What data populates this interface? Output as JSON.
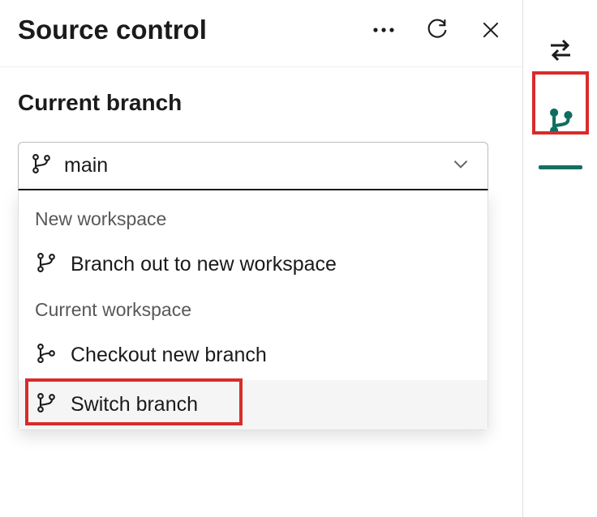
{
  "header": {
    "title": "Source control"
  },
  "section": {
    "label": "Current branch",
    "selected_value": "main"
  },
  "dropdown": {
    "group1_label": "New workspace",
    "item_branch_out": "Branch out to new workspace",
    "group2_label": "Current workspace",
    "item_checkout": "Checkout new branch",
    "item_switch": "Switch branch"
  }
}
